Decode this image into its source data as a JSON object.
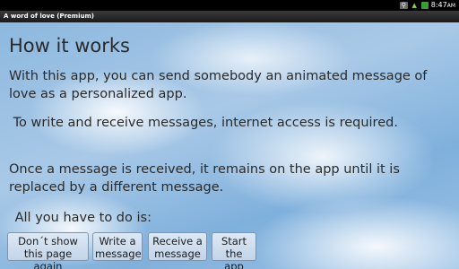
{
  "status_bar": {
    "icons": [
      "usb-icon",
      "wifi-icon",
      "battery-icon"
    ],
    "time": "8:47",
    "time_suffix": "AM"
  },
  "title_bar": {
    "title": "A word of love (Premium)"
  },
  "main": {
    "heading": "How it works",
    "paragraphs": [
      "With this app, you can send somebody an animated message of love as a personalized app.",
      " To write and receive messages, internet access is required.",
      "Once a message is received, it remains on the app until it is replaced by a different message.",
      " All you have to do is:"
    ]
  },
  "buttons": {
    "dont_show": "Don´t show\nthis page again",
    "write": "Write a\nmessage",
    "receive": "Receive a\nmessage",
    "start": "Start\nthe app"
  },
  "colors": {
    "sky": "#8db8df",
    "button_bg": "#c3d4e8",
    "text": "#2a2a2a"
  }
}
